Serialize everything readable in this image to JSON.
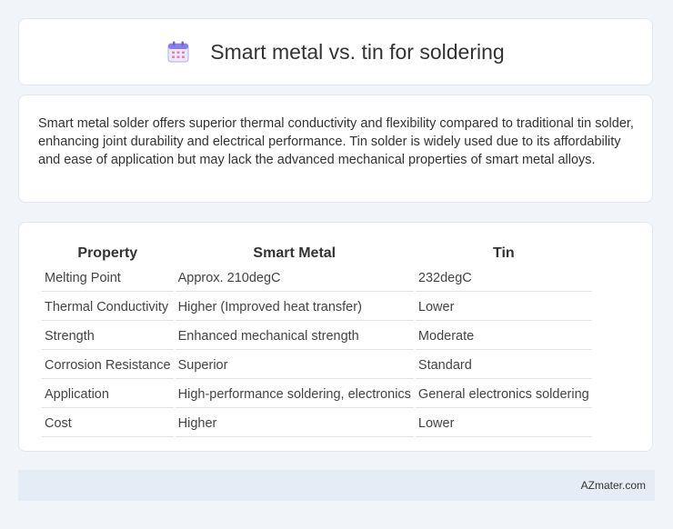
{
  "header": {
    "title": "Smart metal vs. tin for soldering",
    "icon": "calendar-icon",
    "accent_color": "#8a7cf0"
  },
  "summary": {
    "text": "Smart metal solder offers superior thermal conductivity and flexibility compared to traditional tin solder, enhancing joint durability and electrical performance. Tin solder is widely used due to its affordability and ease of application but may lack the advanced mechanical properties of smart metal alloys."
  },
  "table": {
    "columns": [
      "Property",
      "Smart Metal",
      "Tin"
    ],
    "rows": [
      [
        "Melting Point",
        "Approx. 210degC",
        "232degC"
      ],
      [
        "Thermal Conductivity",
        "Higher (Improved heat transfer)",
        "Lower"
      ],
      [
        "Strength",
        "Enhanced mechanical strength",
        "Moderate"
      ],
      [
        "Corrosion Resistance",
        "Superior",
        "Standard"
      ],
      [
        "Application",
        "High-performance soldering, electronics",
        "General electronics soldering"
      ],
      [
        "Cost",
        "Higher",
        "Lower"
      ]
    ]
  },
  "footer": {
    "text": "AZmater.com"
  }
}
